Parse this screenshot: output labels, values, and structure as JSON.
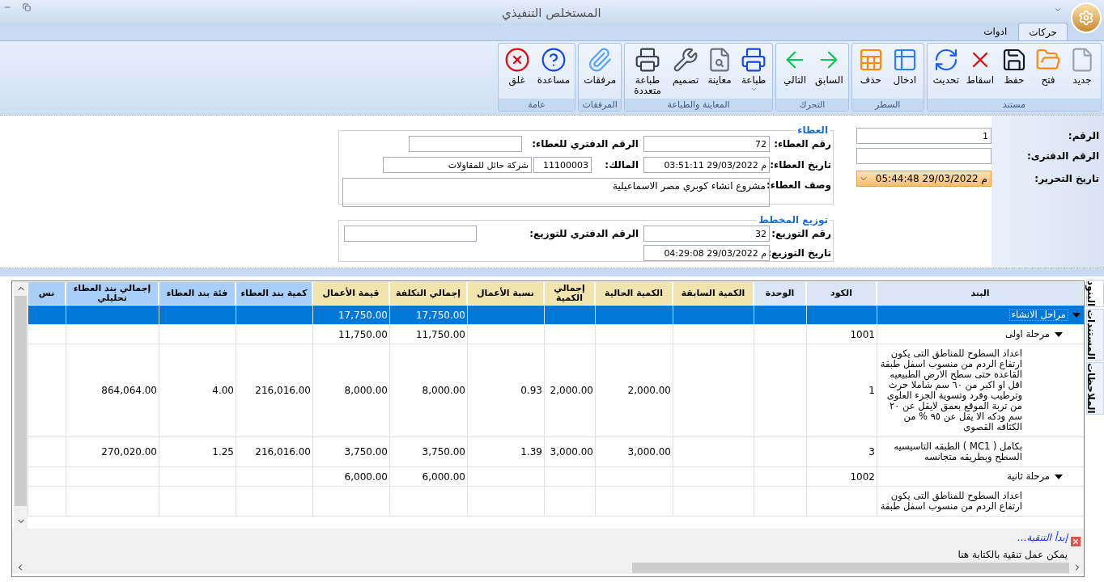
{
  "window": {
    "title": "المستخلص التنفيذي"
  },
  "tabs": [
    {
      "label": "حركات",
      "selected": true
    },
    {
      "label": "ادوات",
      "selected": false
    }
  ],
  "ribbon": {
    "groups": [
      {
        "label": "مستند",
        "buttons": [
          {
            "kind": "new",
            "label": "جديد",
            "dropdown": false
          },
          {
            "kind": "open",
            "label": "فتح",
            "dropdown": false
          },
          {
            "kind": "save",
            "label": "حفظ",
            "dropdown": false
          },
          {
            "kind": "drop",
            "label": "اسقاط",
            "dropdown": false
          },
          {
            "kind": "refresh",
            "label": "تحديث",
            "dropdown": false
          }
        ]
      },
      {
        "label": "السطر",
        "buttons": [
          {
            "kind": "insert",
            "label": "ادخال",
            "dropdown": false
          },
          {
            "kind": "delete",
            "label": "حذف",
            "dropdown": false
          }
        ]
      },
      {
        "label": "التحرك",
        "buttons": [
          {
            "kind": "prev",
            "label": "السابق",
            "dropdown": false
          },
          {
            "kind": "next",
            "label": "التالي",
            "dropdown": false
          }
        ]
      },
      {
        "label": "المعاينة والطباعة",
        "buttons": [
          {
            "kind": "print",
            "label": "طباعة",
            "dropdown": true
          },
          {
            "kind": "preview",
            "label": "معاينة",
            "dropdown": false
          },
          {
            "kind": "design",
            "label": "تصميم",
            "dropdown": false
          },
          {
            "kind": "multiprint",
            "label": "طباعة متعددة",
            "dropdown": false
          }
        ]
      },
      {
        "label": "المرفقات",
        "buttons": [
          {
            "kind": "attach",
            "label": "مرفقات",
            "dropdown": false
          }
        ]
      },
      {
        "label": "عامة",
        "buttons": [
          {
            "kind": "help",
            "label": "مساعدة",
            "dropdown": false
          },
          {
            "kind": "close",
            "label": "غلق",
            "dropdown": false
          }
        ]
      }
    ]
  },
  "header_form": {
    "number": {
      "label": "الرقم:",
      "value": "1"
    },
    "book_number": {
      "label": "الرقم الدفترى:"
    },
    "edit_date": {
      "label": "تاريخ التحرير:",
      "value": "م 29/03/2022 05:44:48"
    }
  },
  "tender": {
    "legend": "العطاء",
    "number": {
      "label": "رقم العطاء:",
      "value": "72"
    },
    "book_number": {
      "label": "الرقم الدفتري للعطاء:"
    },
    "date": {
      "label": "تاريخ العطاء:",
      "value": "م 29/03/2022 03:51:11"
    },
    "owner": {
      "label": "المالك:",
      "code": "11100003",
      "name": "شركة حائل للمقاولات"
    },
    "description": {
      "label": "وصف العطاء:",
      "value": "مشروع انشاء كوبري مصر الاسماعيلية"
    }
  },
  "distribution": {
    "legend": "توزيع المخطط",
    "number": {
      "label": "رقم التوزيع:",
      "value": "32"
    },
    "book_number": {
      "label": "الرقم الدفتري للتوزيع:"
    },
    "date": {
      "label": "تاريخ التوزيع:",
      "value": "م 29/03/2022 04:29:08"
    }
  },
  "grid": {
    "columns": [
      {
        "label": "البند",
        "color": "#dae6f4"
      },
      {
        "label": "الكود",
        "color": "#dae6f4"
      },
      {
        "label": "الوحدة",
        "color": "#dae6f4"
      },
      {
        "label": "الكمية السابقة",
        "color": "#f2e4ae"
      },
      {
        "label": "الكمية الحالية",
        "color": "#f2e4ae"
      },
      {
        "label": "إجمالي الكمية",
        "color": "#f2e4ae"
      },
      {
        "label": "نسبة الأعمال",
        "color": "#f2e4ae"
      },
      {
        "label": "إجمالي التكلفة",
        "color": "#f2e4ae"
      },
      {
        "label": "قيمة الأعمال",
        "color": "#f2e4ae"
      },
      {
        "label": "كمية بند العطاء",
        "color": "#a9cff8"
      },
      {
        "label": "فئة بند العطاء",
        "color": "#a9cff8"
      },
      {
        "label": "إجمالي بند العطاء تحليلي",
        "color": "#a9cff8"
      },
      {
        "label": "نس",
        "color": "#a9cff8"
      }
    ],
    "rows": [
      {
        "kind": "group",
        "item": "مراحل الانشاء",
        "expanded": true,
        "selected": true,
        "values": {
          "total_cost": "17,750.00",
          "work_value": "17,750.00"
        },
        "children": [
          {
            "kind": "group",
            "item": "مرحلة اولى",
            "expanded": true,
            "selected": false,
            "values": {
              "code": "1001",
              "total_cost": "11,750.00",
              "work_value": "11,750.00"
            },
            "children": [
              {
                "kind": "item",
                "item": "اعداد السطوح للمناطق التى يكون ارتفاع الردم من منسوب اسفل طبقة القاعده حتى سطح الارض الطبيعيه اقل او اكبر من ٦٠ سم شاملا حرث وترطيب وفرد وتسوية الجزء العلوى من تربة الموقع بعمق لايقل عن ٢٠ سم ودكه الا يقل عن ٩٥ % من الكثافه القصوى",
                "selected": false,
                "values": {
                  "code": "1",
                  "current_qty": "2,000.00",
                  "total_qty": "2,000.00",
                  "work_percent": "0.93",
                  "total_cost": "8,000.00",
                  "work_value": "8,000.00",
                  "tender_qty": "216,016.00",
                  "tender_rate": "4.00",
                  "tender_total_analytic": "864,064.00"
                }
              },
              {
                "kind": "item",
                "item": "بكامل ( MC1 ) الطبقه التاسيسيه السطح وبطريقه متجانسه",
                "selected": false,
                "values": {
                  "code": "3",
                  "current_qty": "3,000.00",
                  "total_qty": "3,000.00",
                  "work_percent": "1.39",
                  "total_cost": "3,750.00",
                  "work_value": "3,750.00",
                  "tender_qty": "216,016.00",
                  "tender_rate": "1.25",
                  "tender_total_analytic": "270,020.00"
                }
              }
            ]
          },
          {
            "kind": "group",
            "item": "مرحلة ثانية",
            "expanded": true,
            "selected": false,
            "values": {
              "code": "1002",
              "total_cost": "6,000.00",
              "work_value": "6,000.00"
            },
            "children": [
              {
                "kind": "item",
                "item": "اعداد السطوح للمناطق التى يكون ارتفاع الردم من منسوب اسفل طبقة",
                "selected": false
              }
            ]
          }
        ]
      }
    ],
    "filter": {
      "title": "إبدأ التنقية...",
      "hint": "يمكن عمل تنقية بالكتابة هنا"
    }
  },
  "side_tabs": [
    {
      "label": "البنود",
      "selected": true
    },
    {
      "label": "المستندات",
      "selected": false
    },
    {
      "label": "الملاحظات",
      "selected": false
    }
  ]
}
